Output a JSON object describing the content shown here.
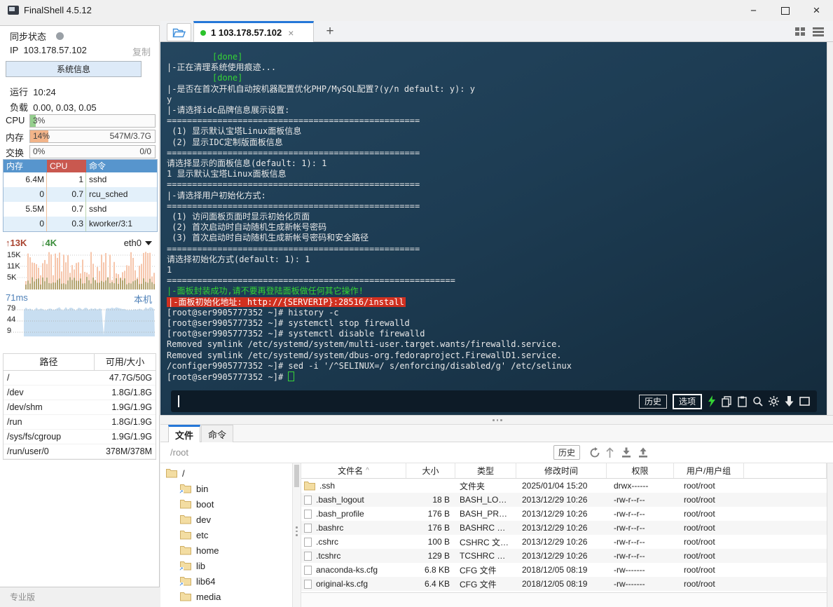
{
  "window": {
    "title": "FinalShell 4.5.12",
    "controls": {
      "minimize": "−",
      "close": "×"
    }
  },
  "colors": {
    "accent_blue": "#2577d8",
    "terminal_green": "#35d435",
    "terminal_red_bg": "#d03020",
    "cpu_fill": "#95cf8e",
    "mem_fill": "#f2b489",
    "net_bar_salmon": "#f6c6ac",
    "net_bar_olive": "#b3a26e",
    "ping_area": "#c8def1",
    "folder_fill": "#f3dda2",
    "folder_stroke": "#cfae63"
  },
  "sidebar": {
    "sync_label": "同步状态",
    "ip_label": "IP",
    "ip": "103.178.57.102",
    "copy_label": "复制",
    "sysinfo_button": "系统信息",
    "uptime_label": "运行",
    "uptime": "10:24",
    "load_label": "负载",
    "load": "0.00, 0.03, 0.05",
    "cpu": {
      "label": "CPU",
      "percent": "3%",
      "value": 3
    },
    "memory": {
      "label": "内存",
      "percent": "14%",
      "value": 14,
      "detail": "547M/3.7G"
    },
    "swap": {
      "label": "交换",
      "percent": "0%",
      "value": 0,
      "detail": "0/0"
    },
    "process_table": {
      "headers": [
        "内存",
        "CPU",
        "命令"
      ],
      "rows": [
        [
          "6.4M",
          "1",
          "sshd"
        ],
        [
          "0",
          "0.7",
          "rcu_sched"
        ],
        [
          "5.5M",
          "0.7",
          "sshd"
        ],
        [
          "0",
          "0.3",
          "kworker/3:1"
        ]
      ]
    },
    "network": {
      "up": "13K",
      "down": "4K",
      "up_arrow": "↑",
      "down_arrow": "↓",
      "interface": "eth0",
      "y_labels": [
        "15K",
        "11K",
        "5K"
      ]
    },
    "ping": {
      "latency": "71ms",
      "target": "本机",
      "y_labels": [
        "79",
        "44",
        "9"
      ]
    },
    "disk_table": {
      "headers": [
        "路径",
        "可用/大小"
      ],
      "rows": [
        [
          "/",
          "47.7G/50G"
        ],
        [
          "/dev",
          "1.8G/1.8G"
        ],
        [
          "/dev/shm",
          "1.9G/1.9G"
        ],
        [
          "/run",
          "1.8G/1.9G"
        ],
        [
          "/sys/fs/cgroup",
          "1.9G/1.9G"
        ],
        [
          "/run/user/0",
          "378M/378M"
        ]
      ]
    },
    "edition": "专业版"
  },
  "tabbar": {
    "tab_title": "1 103.178.57.102",
    "tab_close": "×",
    "new_tab": "+"
  },
  "terminal": {
    "lines": [
      {
        "style": "green",
        "text": "         [done]"
      },
      {
        "style": "plain",
        "text": "|-正在清理系统使用痕迹..."
      },
      {
        "style": "green",
        "text": "         [done]"
      },
      {
        "style": "plain",
        "text": "|-是否在首次开机自动按机器配置优化PHP/MySQL配置?(y/n default: y): y"
      },
      {
        "style": "plain",
        "text": "y"
      },
      {
        "style": "plain",
        "text": "|-请选择idc品牌信息展示设置:"
      },
      {
        "style": "plain",
        "text": "=================================================="
      },
      {
        "style": "plain",
        "text": " (1) 显示默认宝塔Linux面板信息"
      },
      {
        "style": "plain",
        "text": " (2) 显示IDC定制版面板信息"
      },
      {
        "style": "plain",
        "text": "=================================================="
      },
      {
        "style": "plain",
        "text": "请选择显示的面板信息(default: 1): 1"
      },
      {
        "style": "plain",
        "text": "1 显示默认宝塔Linux面板信息"
      },
      {
        "style": "plain",
        "text": "=================================================="
      },
      {
        "style": "plain",
        "text": "|-请选择用户初始化方式:"
      },
      {
        "style": "plain",
        "text": "=================================================="
      },
      {
        "style": "plain",
        "text": " (1) 访问面板页面时显示初始化页面"
      },
      {
        "style": "plain",
        "text": " (2) 首次启动时自动随机生成新帐号密码"
      },
      {
        "style": "plain",
        "text": " (3) 首次启动时自动随机生成新帐号密码和安全路径"
      },
      {
        "style": "plain",
        "text": "=================================================="
      },
      {
        "style": "plain",
        "text": "请选择初始化方式(default: 1): 1"
      },
      {
        "style": "plain",
        "text": "1"
      },
      {
        "style": "plain",
        "text": "========================================================="
      },
      {
        "style": "green",
        "text": "|-面板封装成功,请不要再登陆面板做任何其它操作!"
      },
      {
        "style": "redbg",
        "text": "|-面板初始化地址: http://{SERVERIP}:28516/install"
      },
      {
        "style": "plain",
        "text": "[root@ser9905777352 ~]# history -c"
      },
      {
        "style": "plain",
        "text": "[root@ser9905777352 ~]# systemctl stop firewalld"
      },
      {
        "style": "plain",
        "text": "[root@ser9905777352 ~]# systemctl disable firewalld"
      },
      {
        "style": "plain",
        "text": "Removed symlink /etc/systemd/system/multi-user.target.wants/firewalld.service."
      },
      {
        "style": "plain",
        "text": "Removed symlink /etc/systemd/system/dbus-org.fedoraproject.FirewallD1.service."
      },
      {
        "style": "plain",
        "text": "/configer9905777352 ~]# sed -i '/^SELINUX=/ s/enforcing/disabled/g' /etc/selinux"
      },
      {
        "style": "prompt",
        "text": "[root@ser9905777352 ~]# "
      }
    ],
    "toolbar": {
      "history_button": "历史",
      "options_button": "选项"
    }
  },
  "file_panel": {
    "tabs": {
      "files": "文件",
      "commands": "命令"
    },
    "path": "/root",
    "history_button": "历史",
    "sort_indicator": "^",
    "tree": {
      "root": "/",
      "items": [
        {
          "name": "bin",
          "symlink": true
        },
        {
          "name": "boot",
          "symlink": false
        },
        {
          "name": "dev",
          "symlink": false
        },
        {
          "name": "etc",
          "symlink": false
        },
        {
          "name": "home",
          "symlink": false
        },
        {
          "name": "lib",
          "symlink": true
        },
        {
          "name": "lib64",
          "symlink": true
        },
        {
          "name": "media",
          "symlink": false
        }
      ]
    },
    "table": {
      "headers": [
        "文件名",
        "大小",
        "类型",
        "修改时间",
        "权限",
        "用户/用户组"
      ],
      "rows": [
        {
          "name": ".ssh",
          "size": "",
          "type": "文件夹",
          "mtime": "2025/01/04 15:20",
          "perm": "drwx------",
          "owner": "root/root",
          "icon": "folder"
        },
        {
          "name": ".bash_logout",
          "size": "18 B",
          "type": "BASH_LO…",
          "mtime": "2013/12/29 10:26",
          "perm": "-rw-r--r--",
          "owner": "root/root",
          "icon": "file"
        },
        {
          "name": ".bash_profile",
          "size": "176 B",
          "type": "BASH_PR…",
          "mtime": "2013/12/29 10:26",
          "perm": "-rw-r--r--",
          "owner": "root/root",
          "icon": "file"
        },
        {
          "name": ".bashrc",
          "size": "176 B",
          "type": "BASHRC …",
          "mtime": "2013/12/29 10:26",
          "perm": "-rw-r--r--",
          "owner": "root/root",
          "icon": "file"
        },
        {
          "name": ".cshrc",
          "size": "100 B",
          "type": "CSHRC 文…",
          "mtime": "2013/12/29 10:26",
          "perm": "-rw-r--r--",
          "owner": "root/root",
          "icon": "file"
        },
        {
          "name": ".tcshrc",
          "size": "129 B",
          "type": "TCSHRC …",
          "mtime": "2013/12/29 10:26",
          "perm": "-rw-r--r--",
          "owner": "root/root",
          "icon": "file"
        },
        {
          "name": "anaconda-ks.cfg",
          "size": "6.8 KB",
          "type": "CFG 文件",
          "mtime": "2018/12/05 08:19",
          "perm": "-rw-------",
          "owner": "root/root",
          "icon": "file"
        },
        {
          "name": "original-ks.cfg",
          "size": "6.4 KB",
          "type": "CFG 文件",
          "mtime": "2018/12/05 08:19",
          "perm": "-rw-------",
          "owner": "root/root",
          "icon": "file"
        }
      ]
    }
  }
}
